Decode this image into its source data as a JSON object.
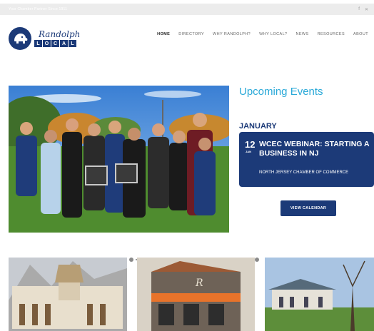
{
  "topbar": {
    "text": "Your Chamber Partner Since 1911",
    "social": [
      "f",
      "✕"
    ]
  },
  "logo": {
    "script": "Randolph",
    "local": [
      "L",
      "O",
      "C",
      "A",
      "L"
    ]
  },
  "nav": [
    "HOME",
    "DIRECTORY",
    "WHY RANDOLPH?",
    "WHY LOCAL?",
    "NEWS",
    "RESOURCES",
    "ABOUT"
  ],
  "events": {
    "title": "Upcoming Events",
    "month": "JANUARY",
    "item": {
      "day": "12",
      "mon": "JAN",
      "title": "WCEC WEBINAR: STARTING A BUSINESS IN NJ",
      "org": "NORTH JERSEY CHAMBER OF COMMERCE"
    },
    "button": "VIEW CALENDAR"
  },
  "colors": {
    "brand": "#1c3a78",
    "accent": "#2aa9d8"
  }
}
